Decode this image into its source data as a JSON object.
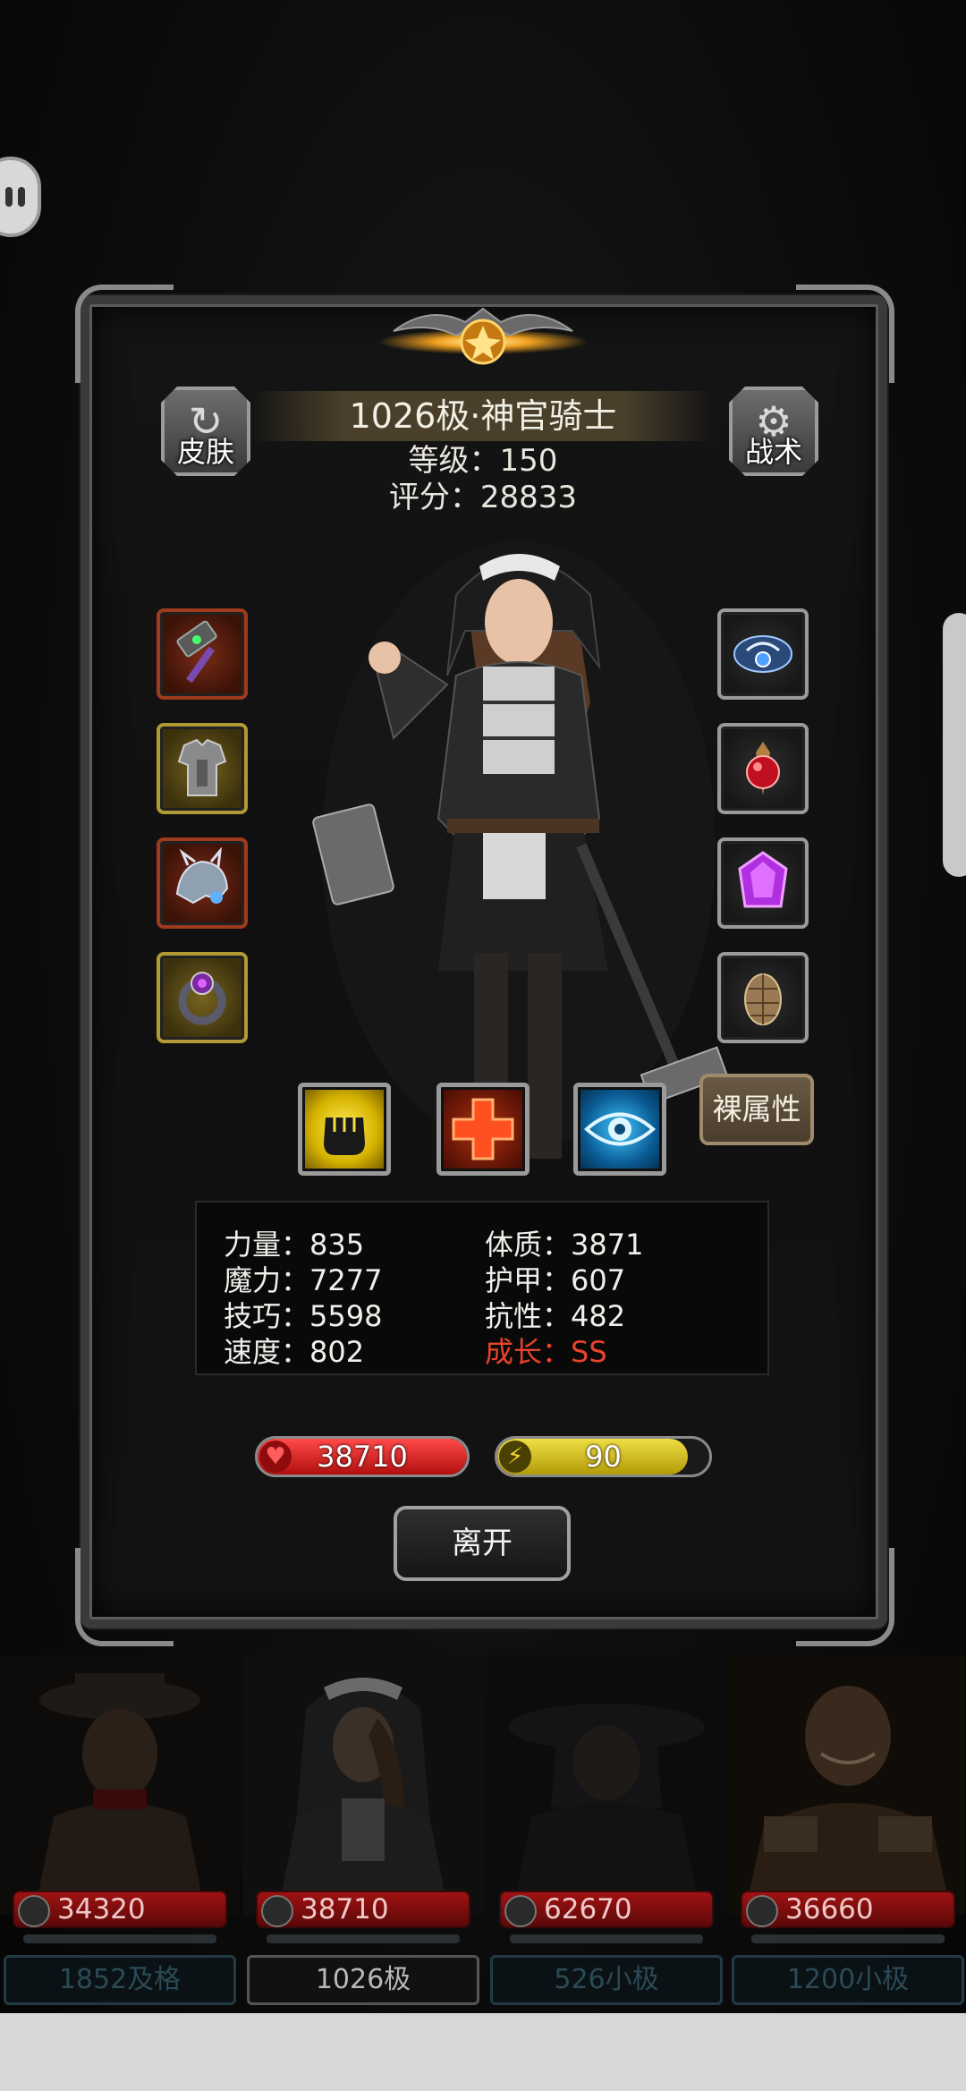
{
  "panel": {
    "title": "1026极·神官骑士",
    "level_line": "等级：150",
    "score_line": "评分：28833"
  },
  "buttons": {
    "skin_label": "皮肤",
    "tactics_label": "战术",
    "bare_attr_label": "裸属性",
    "leave_label": "离开"
  },
  "equipment": {
    "left": [
      {
        "name": "hammer-weapon-icon",
        "rarity": "red"
      },
      {
        "name": "armor-icon",
        "rarity": "gold"
      },
      {
        "name": "dragon-helm-icon",
        "rarity": "red"
      },
      {
        "name": "ring-icon",
        "rarity": "gold"
      }
    ],
    "right": [
      {
        "name": "amulet-icon",
        "rarity": "plain"
      },
      {
        "name": "red-gem-trinket-icon",
        "rarity": "plain"
      },
      {
        "name": "purple-crystal-icon",
        "rarity": "plain"
      },
      {
        "name": "shell-shield-icon",
        "rarity": "plain"
      }
    ]
  },
  "skills": [
    "fist-skill-icon",
    "cross-heal-skill-icon",
    "eye-skill-icon"
  ],
  "stats": {
    "strength": "力量：835",
    "magic": "魔力：7277",
    "skill": "技巧：5598",
    "speed": "速度：802",
    "constitution": "体质：3871",
    "armor": "护甲：607",
    "resistance": "抗性：482",
    "growth": "成长：SS"
  },
  "bars": {
    "hp": "38710",
    "hp_fraction": 1.0,
    "energy": "90",
    "energy_fraction": 0.9
  },
  "roster": [
    {
      "power": "34320",
      "tag": "1852及格",
      "active": false
    },
    {
      "power": "38710",
      "tag": "1026极",
      "active": true
    },
    {
      "power": "62670",
      "tag": "526小极",
      "active": false
    },
    {
      "power": "36660",
      "tag": "1200小极",
      "active": false
    }
  ],
  "colors": {
    "growth_red": "#e8432b",
    "hp_red": "#c41414",
    "energy_yellow": "#e0c920"
  }
}
